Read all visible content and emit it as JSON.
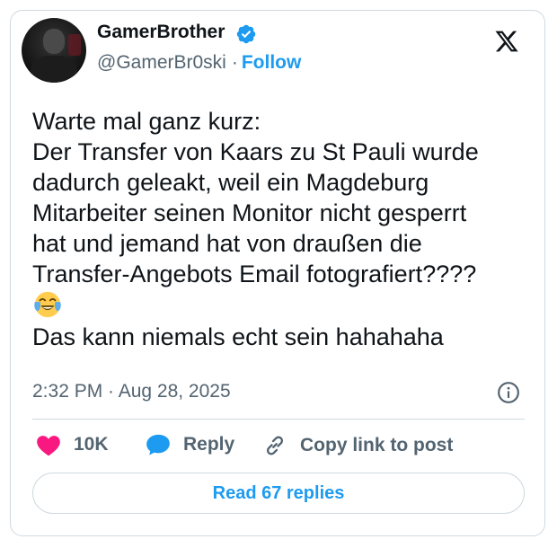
{
  "author": {
    "display_name": "GamerBrother",
    "handle": "@GamerBr0ski",
    "separator": "·",
    "follow_label": "Follow"
  },
  "tweet": {
    "lines": [
      "Warte mal ganz kurz:",
      "Der Transfer von Kaars zu St Pauli wurde",
      "dadurch geleakt, weil ein Magdeburg",
      "Mitarbeiter seinen Monitor nicht gesperrt",
      "hat und jemand hat von draußen die",
      "Transfer-Angebots Email fotografiert????",
      "Das kann niemals echt sein hahahaha"
    ],
    "emoji": "face-with-tears-of-joy",
    "timestamp": "2:32 PM · Aug 28, 2025"
  },
  "actions": {
    "likes_count": "10K",
    "reply_label": "Reply",
    "copy_label": "Copy link to post"
  },
  "read_replies_label": "Read 67 replies",
  "colors": {
    "accent": "#1d9bf0",
    "like": "#f91880",
    "text": "#0f1419",
    "muted": "#536471",
    "border": "#cfd9de"
  },
  "icons": [
    "verified-badge-icon",
    "x-logo-icon",
    "info-icon",
    "heart-icon",
    "reply-bubble-icon",
    "link-icon",
    "emoji-icon"
  ]
}
